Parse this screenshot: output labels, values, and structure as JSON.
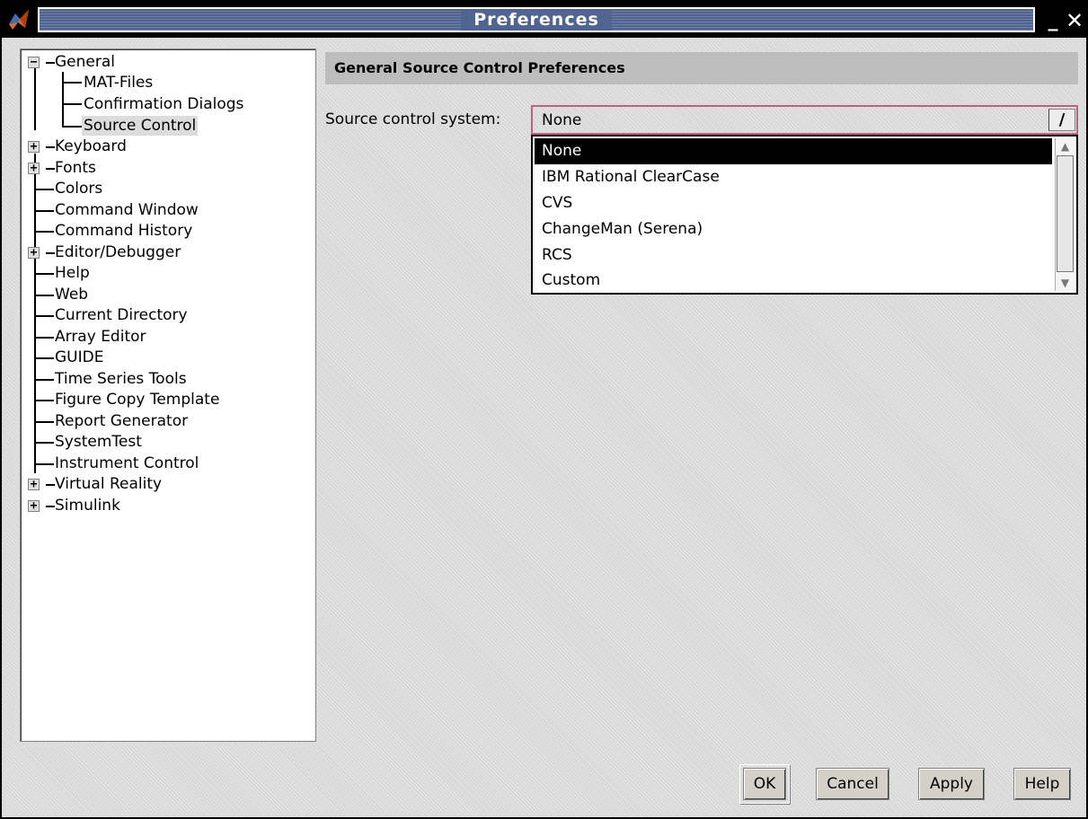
{
  "window": {
    "title": "Preferences",
    "minimize_label": "_",
    "close_label": "✕"
  },
  "tree": {
    "items": [
      {
        "label": "General",
        "expander": "−",
        "level": 0,
        "selected": false
      },
      {
        "label": "MAT-Files",
        "level": 1,
        "selected": false
      },
      {
        "label": "Confirmation Dialogs",
        "level": 1,
        "selected": false
      },
      {
        "label": "Source Control",
        "level": 1,
        "selected": true
      },
      {
        "label": "Keyboard",
        "expander": "+",
        "level": 0,
        "selected": false
      },
      {
        "label": "Fonts",
        "expander": "+",
        "level": 0,
        "selected": false
      },
      {
        "label": "Colors",
        "level": 0,
        "selected": false
      },
      {
        "label": "Command Window",
        "level": 0,
        "selected": false
      },
      {
        "label": "Command History",
        "level": 0,
        "selected": false
      },
      {
        "label": "Editor/Debugger",
        "expander": "+",
        "level": 0,
        "selected": false
      },
      {
        "label": "Help",
        "level": 0,
        "selected": false
      },
      {
        "label": "Web",
        "level": 0,
        "selected": false
      },
      {
        "label": "Current Directory",
        "level": 0,
        "selected": false
      },
      {
        "label": "Array Editor",
        "level": 0,
        "selected": false
      },
      {
        "label": "GUIDE",
        "level": 0,
        "selected": false
      },
      {
        "label": "Time Series Tools",
        "level": 0,
        "selected": false
      },
      {
        "label": "Figure Copy Template",
        "level": 0,
        "selected": false
      },
      {
        "label": "Report Generator",
        "level": 0,
        "selected": false
      },
      {
        "label": "SystemTest",
        "level": 0,
        "selected": false
      },
      {
        "label": "Instrument Control",
        "level": 0,
        "selected": false
      },
      {
        "label": "Virtual Reality",
        "expander": "+",
        "level": 0,
        "selected": false
      },
      {
        "label": "Simulink",
        "expander": "+",
        "level": 0,
        "selected": false
      }
    ]
  },
  "main": {
    "section_title": "General Source Control Preferences",
    "source_control_label": "Source control system:",
    "source_control_value": "None",
    "combo_arrow": "/",
    "options": [
      {
        "label": "None",
        "selected": true
      },
      {
        "label": "IBM Rational ClearCase",
        "selected": false
      },
      {
        "label": "CVS",
        "selected": false
      },
      {
        "label": "ChangeMan (Serena)",
        "selected": false
      },
      {
        "label": "RCS",
        "selected": false
      },
      {
        "label": "Custom",
        "selected": false
      }
    ]
  },
  "buttons": {
    "ok": "OK",
    "cancel": "Cancel",
    "apply": "Apply",
    "help": "Help"
  }
}
